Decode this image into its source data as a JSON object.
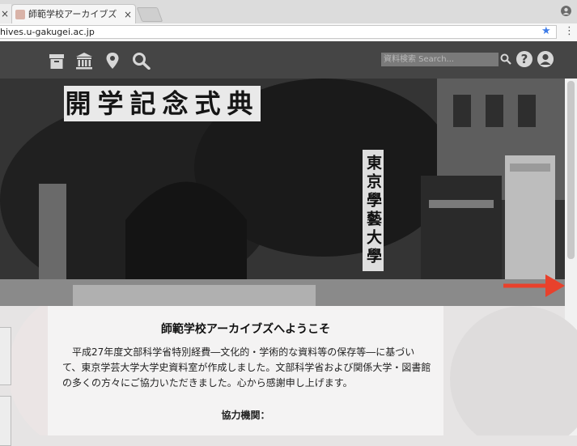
{
  "browser": {
    "tabs": [
      {
        "title": "",
        "close": "×"
      },
      {
        "title": "師範学校アーカイブズ トップペー",
        "close": "×"
      }
    ],
    "url": "hives.u-gakugei.ac.jp"
  },
  "header": {
    "nav_icons": [
      "archive-box-icon",
      "museum-icon",
      "map-pin-icon",
      "search-icon"
    ],
    "search_placeholder": "資料検索 Search...",
    "help_label": "?"
  },
  "hero": {
    "banner_text": "開学記念式典",
    "sign_text": "東京學藝大學"
  },
  "content": {
    "welcome_title": "師範学校アーカイブズへようこそ",
    "intro": "平成27年度文部科学省特別経費―文化的・学術的な資料等の保存等―に基づいて、東京学芸大学大学史資料室が作成しました。文部科学省および関係大学・図書館の多くの方々にご協力いただきました。心から感謝申し上げます。",
    "partners_heading": "協力機関："
  },
  "colors": {
    "header_bg": "#454545",
    "accent_arrow": "#e8412c",
    "star": "#3e7ce8"
  }
}
